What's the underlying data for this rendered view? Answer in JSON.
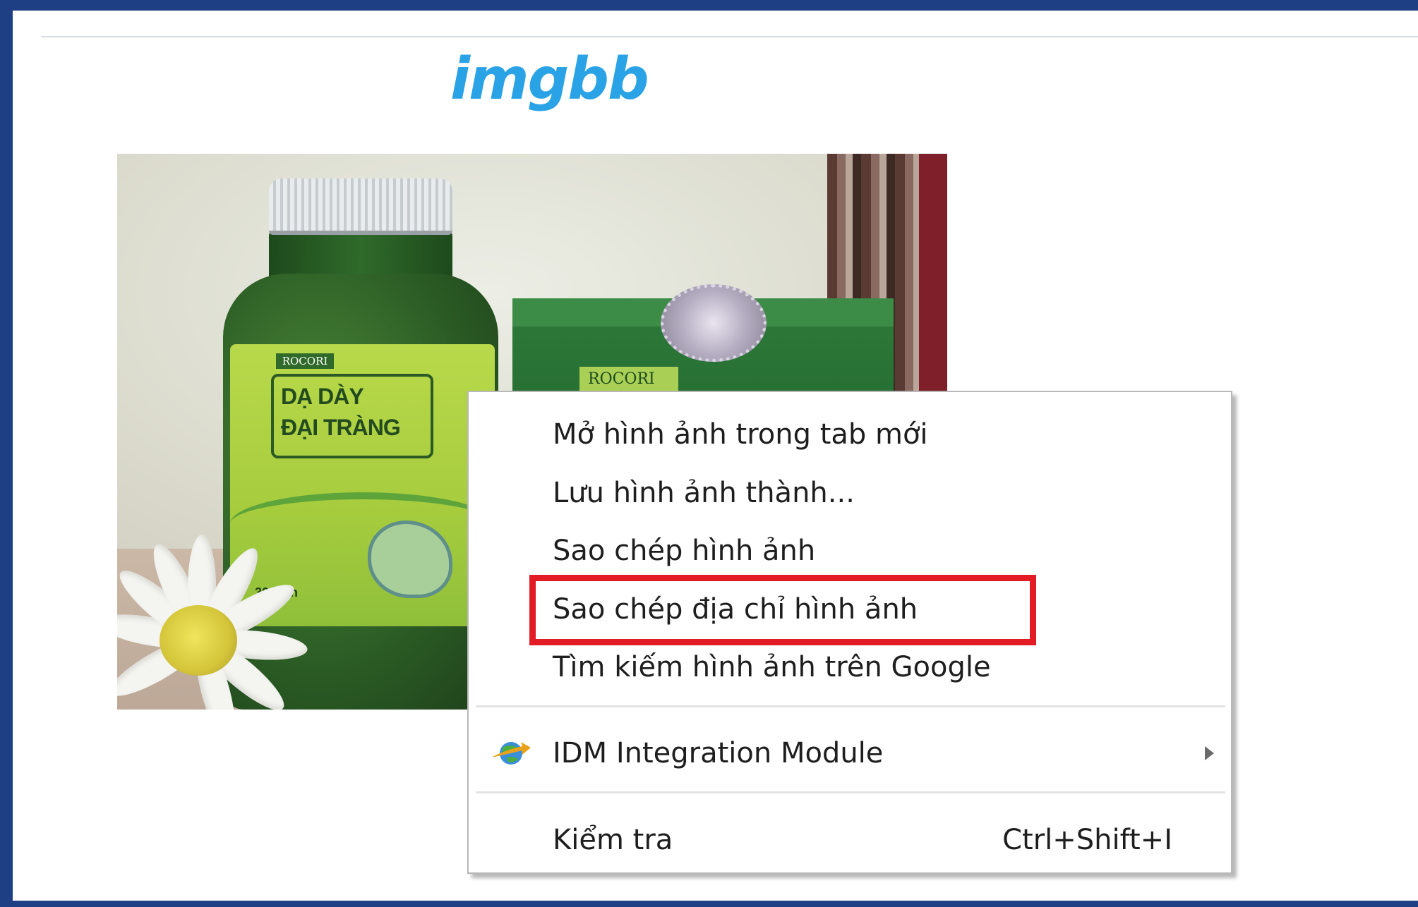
{
  "logo": {
    "text": "imgbb",
    "color": "#2aa3e6"
  },
  "photo": {
    "jar_badge": "ROCORI",
    "jar_title_line1": "DẠ DÀY",
    "jar_title_line2": "ĐẠI TRÀNG",
    "jar_count": "30 viên",
    "box_badge": "ROCORI"
  },
  "context_menu": {
    "items": [
      {
        "label": "Mở hình ảnh trong tab mới"
      },
      {
        "label": "Lưu hình ảnh thành..."
      },
      {
        "label": "Sao chép hình ảnh"
      },
      {
        "label": "Sao chép địa chỉ hình ảnh",
        "highlighted": true
      },
      {
        "label": "Tìm kiếm hình ảnh trên Google"
      }
    ],
    "idm": {
      "label": "IDM Integration Module",
      "icon": "idm-globe-icon",
      "has_submenu": true
    },
    "inspect": {
      "label": "Kiểm tra",
      "shortcut": "Ctrl+Shift+I"
    }
  },
  "colors": {
    "frame": "#1f3f84",
    "highlight_box": "#e21b24"
  }
}
